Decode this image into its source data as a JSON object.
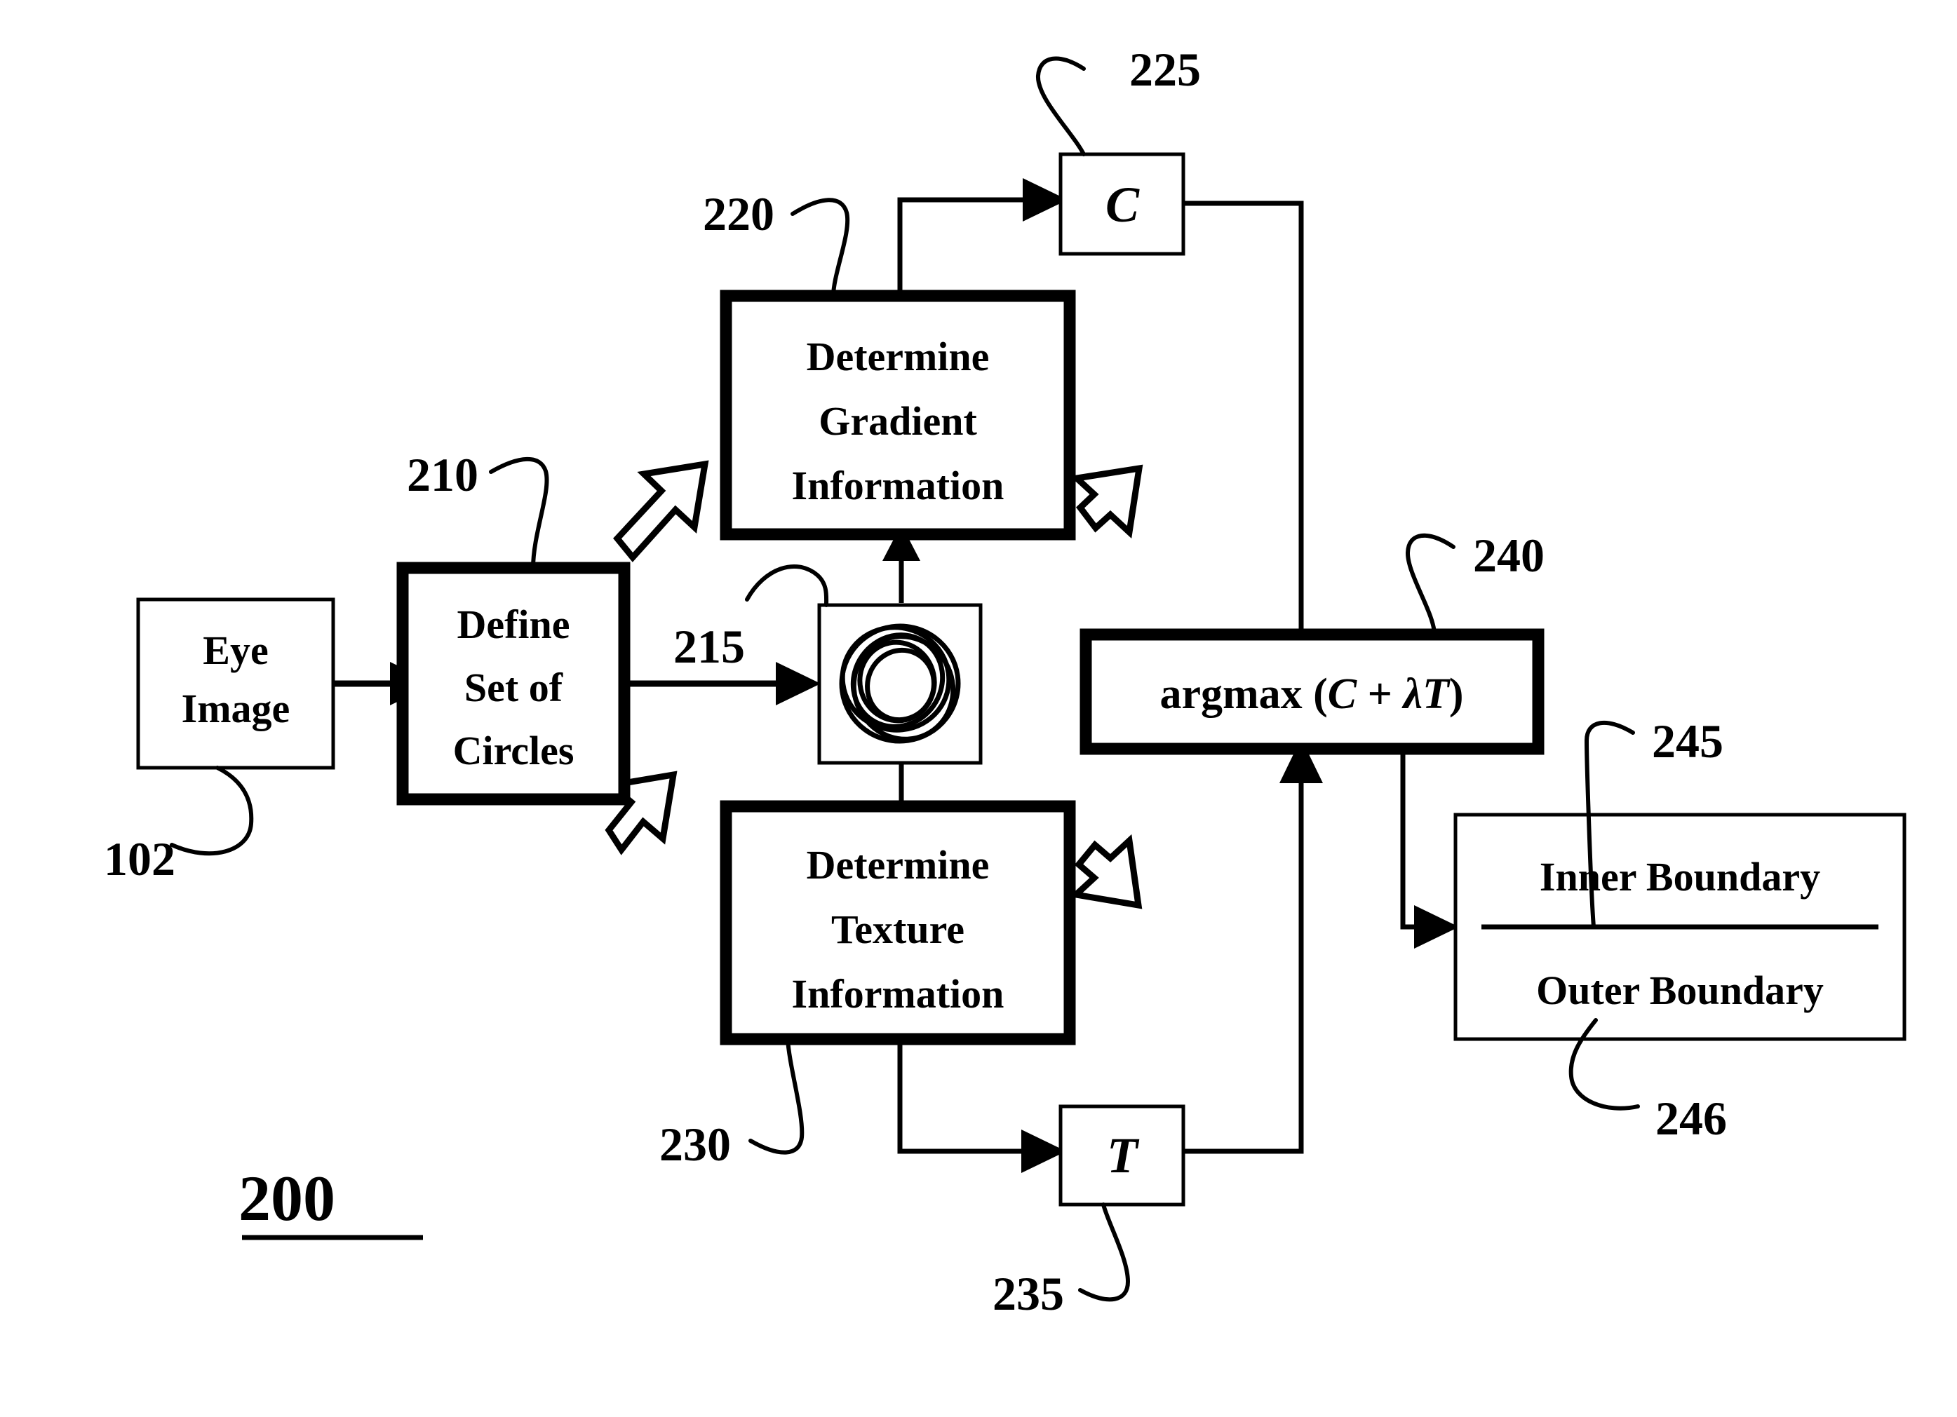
{
  "figure": {
    "number": "200",
    "underlined": true
  },
  "nodes": {
    "eye_image": {
      "line1": "Eye",
      "line2": "Image",
      "ref": "102",
      "border": "thin"
    },
    "define_circles": {
      "line1": "Define",
      "line2": "Set of",
      "line3": "Circles",
      "ref": "210",
      "border": "thick"
    },
    "circles_icon": {
      "ref": "215",
      "icon": "overlapping-circles-icon",
      "border": "thin"
    },
    "gradient": {
      "line1": "Determine",
      "line2": "Gradient",
      "line3": "Information",
      "ref": "220",
      "border": "thick"
    },
    "texture": {
      "line1": "Determine",
      "line2": "Texture",
      "line3": "Information",
      "ref": "230",
      "border": "thick"
    },
    "c_box": {
      "symbol": "C",
      "ref": "225",
      "border": "thin"
    },
    "t_box": {
      "symbol": "T",
      "ref": "235",
      "border": "thin"
    },
    "argmax": {
      "prefix": "argmax (",
      "term_c": "C",
      "operator": " + ",
      "lambda": "λ",
      "term_t": "T",
      "suffix": ")",
      "full_text": "argmax (C + λT)",
      "ref": "240",
      "border": "thick"
    },
    "boundaries": {
      "inner": "Inner Boundary",
      "outer": "Outer Boundary",
      "ref_inner": "245",
      "ref_outer": "246",
      "border": "thin"
    }
  },
  "reference_numerals": [
    "102",
    "210",
    "215",
    "220",
    "225",
    "230",
    "235",
    "240",
    "245",
    "246",
    "200"
  ],
  "colors": {
    "ink": "#000000",
    "paper": "#ffffff"
  }
}
